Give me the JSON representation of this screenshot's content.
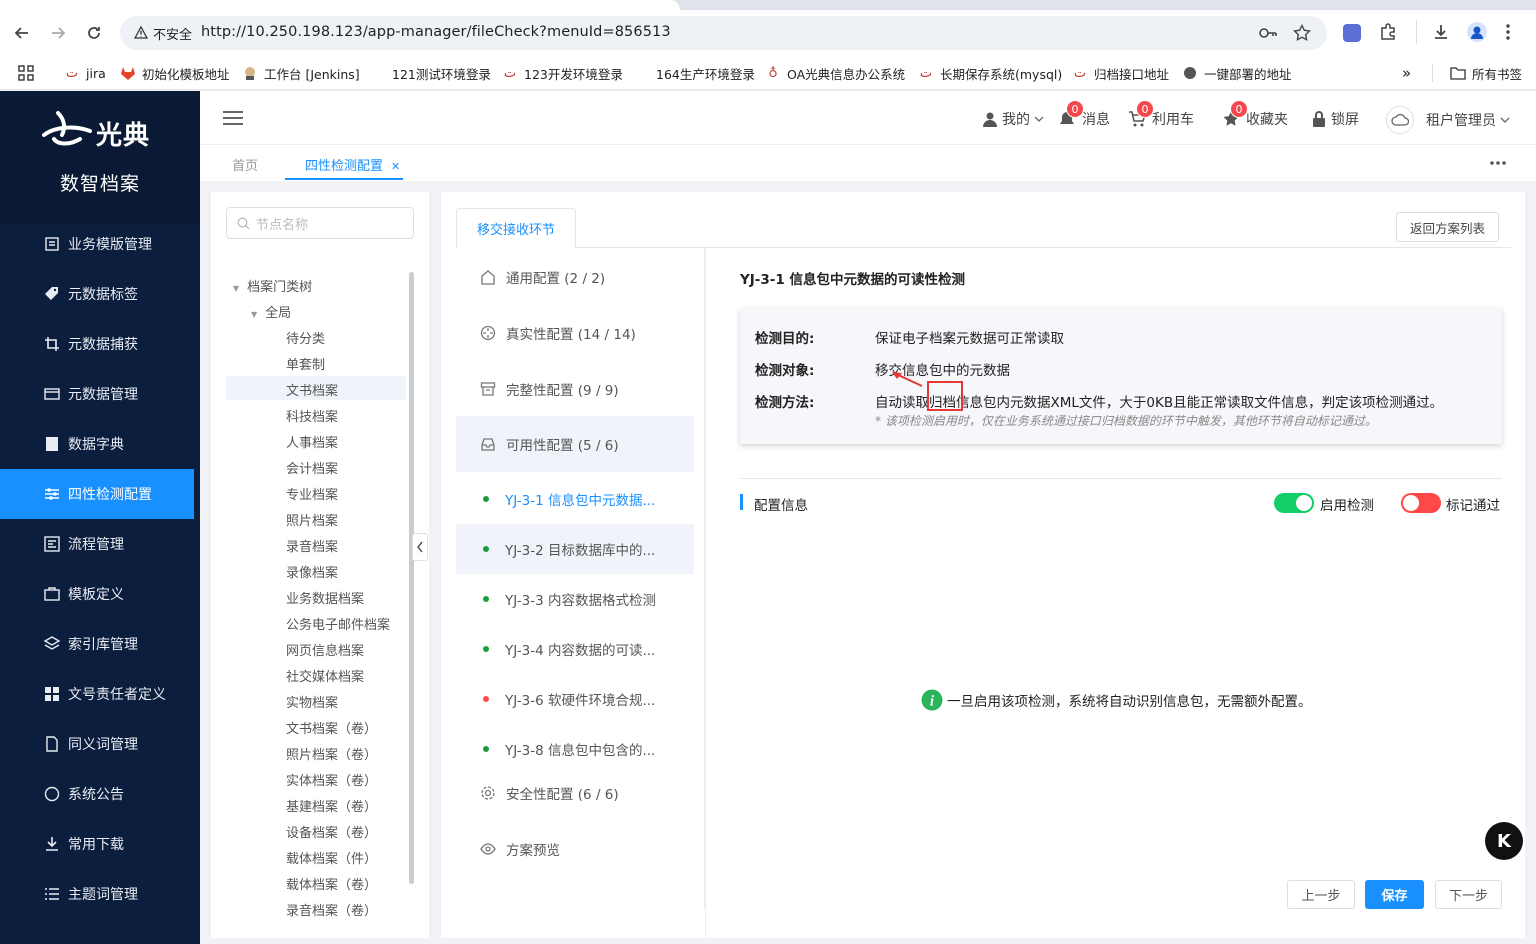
{
  "browser": {
    "insecure_label": "不安全",
    "url": "http://10.250.198.123/app-manager/fileCheck?menuId=856513",
    "bookmarks": [
      "jira",
      "初始化模板地址",
      "工作台 [Jenkins]",
      "121测试环境登录",
      "123开发环境登录",
      "164生产环境登录",
      "OA光典信息办公系统",
      "长期保存系统(mysql)",
      "归档接口地址",
      "一键部署的地址"
    ],
    "all_bookmarks": "所有书签"
  },
  "sidebar": {
    "brand": "光典",
    "title": "数智档案",
    "items": [
      {
        "label": "业务模版管理",
        "icon": "template-icon"
      },
      {
        "label": "元数据标签",
        "icon": "tag-icon"
      },
      {
        "label": "元数据捕获",
        "icon": "crop-icon"
      },
      {
        "label": "元数据管理",
        "icon": "card-icon"
      },
      {
        "label": "数据字典",
        "icon": "book-icon"
      },
      {
        "label": "四性检测配置",
        "icon": "sliders-icon",
        "active": true
      },
      {
        "label": "流程管理",
        "icon": "flow-icon"
      },
      {
        "label": "模板定义",
        "icon": "briefcase-icon"
      },
      {
        "label": "索引库管理",
        "icon": "layers-icon"
      },
      {
        "label": "文号责任者定义",
        "icon": "grid-icon"
      },
      {
        "label": "同义词管理",
        "icon": "document-icon"
      },
      {
        "label": "系统公告",
        "icon": "chat-icon"
      },
      {
        "label": "常用下载",
        "icon": "download-icon"
      },
      {
        "label": "主题词管理",
        "icon": "list-icon"
      }
    ]
  },
  "header": {
    "mine": "我的",
    "messages": "消息",
    "messages_count": "0",
    "cart": "利用车",
    "cart_count": "0",
    "favorites": "收藏夹",
    "favorites_count": "0",
    "lock": "锁屏",
    "user": "租户管理员"
  },
  "page_tabs": {
    "home": "首页",
    "current": "四性检测配置"
  },
  "tree": {
    "search_placeholder": "节点名称",
    "root": "档案门类树",
    "child": "全局",
    "leaves": [
      "待分类",
      "单套制",
      "文书档案",
      "科技档案",
      "人事档案",
      "会计档案",
      "专业档案",
      "照片档案",
      "录音档案",
      "录像档案",
      "业务数据档案",
      "公务电子邮件档案",
      "网页信息档案",
      "社交媒体档案",
      "实物档案",
      "文书档案（卷）",
      "照片档案（卷）",
      "实体档案（卷）",
      "基建档案（卷）",
      "设备档案（卷）",
      "载体档案（件）",
      "载体档案（卷）",
      "录音档案（卷）"
    ],
    "selected_index": 2
  },
  "main": {
    "subtab": "移交接收环节",
    "back_button": "返回方案列表",
    "categories": [
      {
        "label": "通用配置 (2 / 2)",
        "icon": "home-icon"
      },
      {
        "label": "真实性配置 (14 / 14)",
        "icon": "crosshair-icon"
      },
      {
        "label": "完整性配置 (9 / 9)",
        "icon": "archive-icon"
      },
      {
        "label": "可用性配置 (5 / 6)",
        "icon": "inbox-icon"
      }
    ],
    "sub_items": [
      {
        "label": "YJ-3-1 信息包中元数据...",
        "status": "green"
      },
      {
        "label": "YJ-3-2 目标数据库中的...",
        "status": "green"
      },
      {
        "label": "YJ-3-3 内容数据格式检测",
        "status": "green"
      },
      {
        "label": "YJ-3-4 内容数据的可读...",
        "status": "green"
      },
      {
        "label": "YJ-3-6 软硬件环境合规...",
        "status": "red"
      },
      {
        "label": "YJ-3-8 信息包中包含的...",
        "status": "green"
      }
    ],
    "security": "安全性配置 (6 / 6)",
    "preview": "方案预览",
    "detail": {
      "title": "YJ-3-1 信息包中元数据的可读性检测",
      "purpose_label": "检测目的:",
      "purpose": "保证电子档案元数据可正常读取",
      "object_label": "检测对象:",
      "object": "移交信息包中的元数据",
      "method_label": "检测方法:",
      "method": "自动读取归档信息包内元数据XML文件，大于0KB且能正常读取文件信息，判定该项检测通过。",
      "note": "* 该项检测启用时，仅在业务系统通过接口归档数据的环节中触发，其他环节将自动标记通过。"
    },
    "config_title": "配置信息",
    "enable_label": "启用检测",
    "mark_label": "标记通过",
    "hint": "一旦启用该项检测，系统将自动识别信息包，无需额外配置。",
    "prev": "上一步",
    "save": "保存",
    "next": "下一步"
  },
  "colors": {
    "accent": "#1890ff",
    "sidebar": "#0c1e3d",
    "green": "#13ce66",
    "red": "#ff4949"
  }
}
